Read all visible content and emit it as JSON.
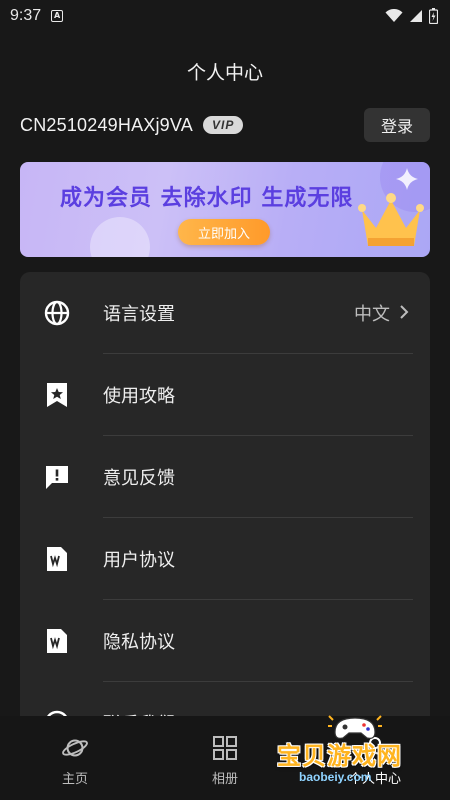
{
  "status_bar": {
    "time": "9:37",
    "notification_letter": "A",
    "icons": [
      "wifi-icon",
      "signal-icon",
      "battery-icon"
    ]
  },
  "page": {
    "title": "个人中心"
  },
  "user": {
    "id": "CN2510249HAXj9VA",
    "badge": "VIP",
    "login_label": "登录"
  },
  "banner": {
    "headline": "成为会员 去除水印 生成无限",
    "button_label": "立即加入",
    "icon": "crown-icon"
  },
  "menu": {
    "items": [
      {
        "label": "语言设置",
        "icon": "globe-icon",
        "value": "中文",
        "has_chevron": true
      },
      {
        "label": "使用攻略",
        "icon": "bookmark-star-icon"
      },
      {
        "label": "意见反馈",
        "icon": "feedback-icon"
      },
      {
        "label": "用户协议",
        "icon": "document-icon"
      },
      {
        "label": "隐私协议",
        "icon": "document-icon"
      },
      {
        "label": "联系我们",
        "icon": "contact-icon"
      }
    ]
  },
  "bottom_nav": {
    "items": [
      {
        "label": "主页",
        "icon": "planet-icon"
      },
      {
        "label": "相册",
        "icon": "grid-icon"
      },
      {
        "label": "个人中心",
        "icon": "person-icon"
      }
    ]
  },
  "watermark": {
    "title": "宝贝游戏网",
    "url": "baobeiy.com"
  },
  "colors": {
    "background": "#181818",
    "card": "#272727",
    "banner_text": "#5b3fe0",
    "banner_button": "#ff9a2a"
  }
}
